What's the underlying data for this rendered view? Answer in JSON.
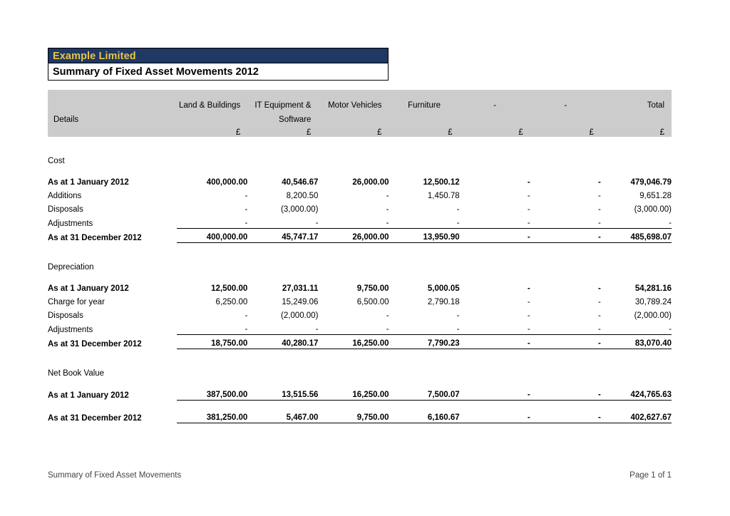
{
  "document": {
    "company": "Example Limited",
    "report_title": "Summary of Fixed Asset Movements 2012",
    "accent_navy": "#1F3864",
    "accent_gold": "#E8C547",
    "header_fill": "#cccccc"
  },
  "table": {
    "columns": [
      {
        "label": "Details",
        "currency": ""
      },
      {
        "label": "Land & Buildings",
        "currency": "£"
      },
      {
        "label": "IT Equipment &",
        "label2": "Software",
        "currency": "£"
      },
      {
        "label": "Motor Vehicles",
        "currency": "£"
      },
      {
        "label": "Furniture",
        "currency": "£"
      },
      {
        "label": "-",
        "currency": "£"
      },
      {
        "label": "-",
        "currency": "£"
      },
      {
        "label": "Total",
        "currency": "£"
      }
    ]
  },
  "sections": [
    {
      "heading": "Cost",
      "rows": [
        {
          "label": "As at 1 January 2012",
          "bold": true,
          "values": [
            "400,000.00",
            "40,546.67",
            "26,000.00",
            "12,500.12",
            "-",
            "-",
            "479,046.79"
          ]
        },
        {
          "label": "Additions",
          "bold": false,
          "values": [
            "-",
            "8,200.50",
            "-",
            "1,450.78",
            "-",
            "-",
            "9,651.28"
          ]
        },
        {
          "label": "Disposals",
          "bold": false,
          "values": [
            "-",
            "(3,000.00)",
            "-",
            "-",
            "-",
            "-",
            "(3,000.00)"
          ]
        },
        {
          "label": "Adjustments",
          "bold": false,
          "values": [
            "-",
            "-",
            "-",
            "-",
            "-",
            "-",
            "-"
          ]
        },
        {
          "label": "As at 31 December 2012",
          "bold": true,
          "totals": true,
          "values": [
            "400,000.00",
            "45,747.17",
            "26,000.00",
            "13,950.90",
            "-",
            "-",
            "485,698.07"
          ]
        }
      ]
    },
    {
      "heading": "Depreciation",
      "rows": [
        {
          "label": "As at 1 January 2012",
          "bold": true,
          "values": [
            "12,500.00",
            "27,031.11",
            "9,750.00",
            "5,000.05",
            "-",
            "-",
            "54,281.16"
          ]
        },
        {
          "label": "Charge for year",
          "bold": false,
          "values": [
            "6,250.00",
            "15,249.06",
            "6,500.00",
            "2,790.18",
            "-",
            "-",
            "30,789.24"
          ]
        },
        {
          "label": "Disposals",
          "bold": false,
          "values": [
            "-",
            "(2,000.00)",
            "-",
            "-",
            "-",
            "-",
            "(2,000.00)"
          ]
        },
        {
          "label": "Adjustments",
          "bold": false,
          "values": [
            "-",
            "-",
            "-",
            "-",
            "-",
            "-",
            "-"
          ]
        },
        {
          "label": "As at 31 December 2012",
          "bold": true,
          "totals": true,
          "values": [
            "18,750.00",
            "40,280.17",
            "16,250.00",
            "7,790.23",
            "-",
            "-",
            "83,070.40"
          ]
        }
      ]
    },
    {
      "heading": "Net Book Value",
      "rows": [
        {
          "label": "As at 1 January 2012",
          "bold": true,
          "nbv": true,
          "values": [
            "387,500.00",
            "13,515.56",
            "16,250.00",
            "7,500.07",
            "-",
            "-",
            "424,765.63"
          ]
        },
        {
          "label": "As at 31 December 2012",
          "bold": true,
          "nbv": true,
          "gap_before": true,
          "values": [
            "381,250.00",
            "5,467.00",
            "9,750.00",
            "6,160.67",
            "-",
            "-",
            "402,627.67"
          ]
        }
      ]
    }
  ],
  "footer": {
    "left": "Summary of Fixed Asset Movements",
    "right": "Page 1 of 1"
  }
}
